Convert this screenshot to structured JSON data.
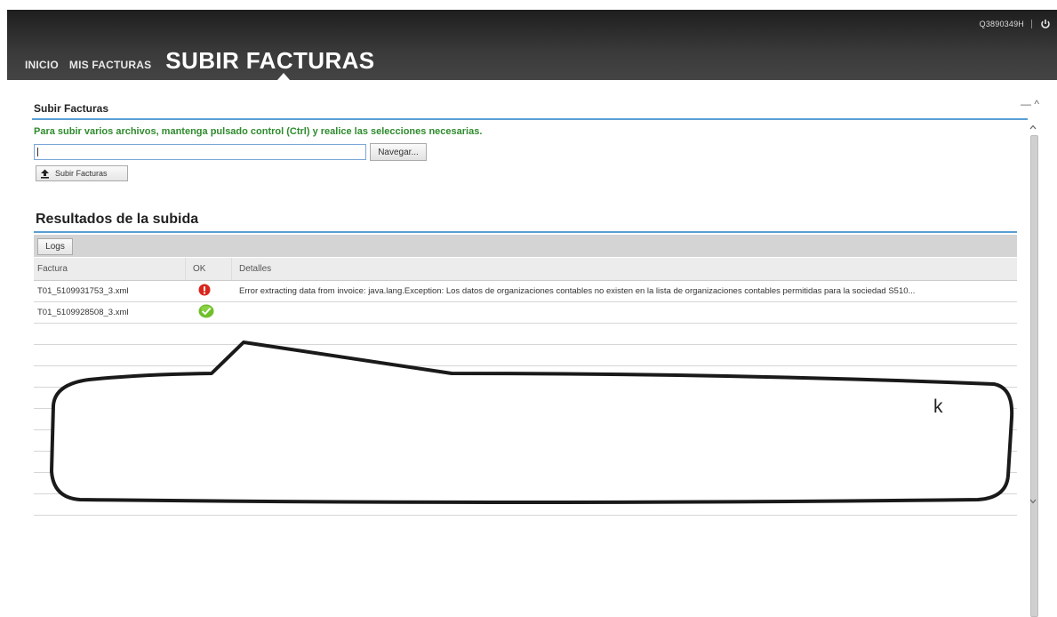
{
  "header": {
    "user_id": "Q3890349H",
    "nav": [
      "INICIO",
      "MIS FACTURAS",
      "SUBIR FACTURAS"
    ]
  },
  "upload": {
    "title": "Subir Facturas",
    "hint": "Para subir varios archivos, mantenga pulsado control (Ctrl) y realice las selecciones necesarias.",
    "file_value": "",
    "browse_label": "Navegar...",
    "upload_button_label": "Subir Facturas",
    "minimize_label": "— ^"
  },
  "results": {
    "title": "Resultados de la subida",
    "logs_label": "Logs",
    "columns": [
      "Factura",
      "OK",
      "Detalles"
    ],
    "rows": [
      {
        "factura": "T01_5109931753_3.xml",
        "status": "error",
        "detalles": "Error extracting data from invoice: java.lang.Exception: Los datos de organizaciones contables no existen en la lista de organizaciones contables permitidas para la sociedad S510..."
      },
      {
        "factura": "T01_5109928508_3.xml",
        "status": "ok",
        "detalles": ""
      }
    ]
  },
  "callout": {
    "text": "k"
  },
  "colors": {
    "header_bg": "#2b2b2b",
    "accent_line": "#5a9fd4",
    "hint_green": "#2e8b2e",
    "error_red": "#d9261c",
    "ok_green": "#6fbf2a"
  }
}
